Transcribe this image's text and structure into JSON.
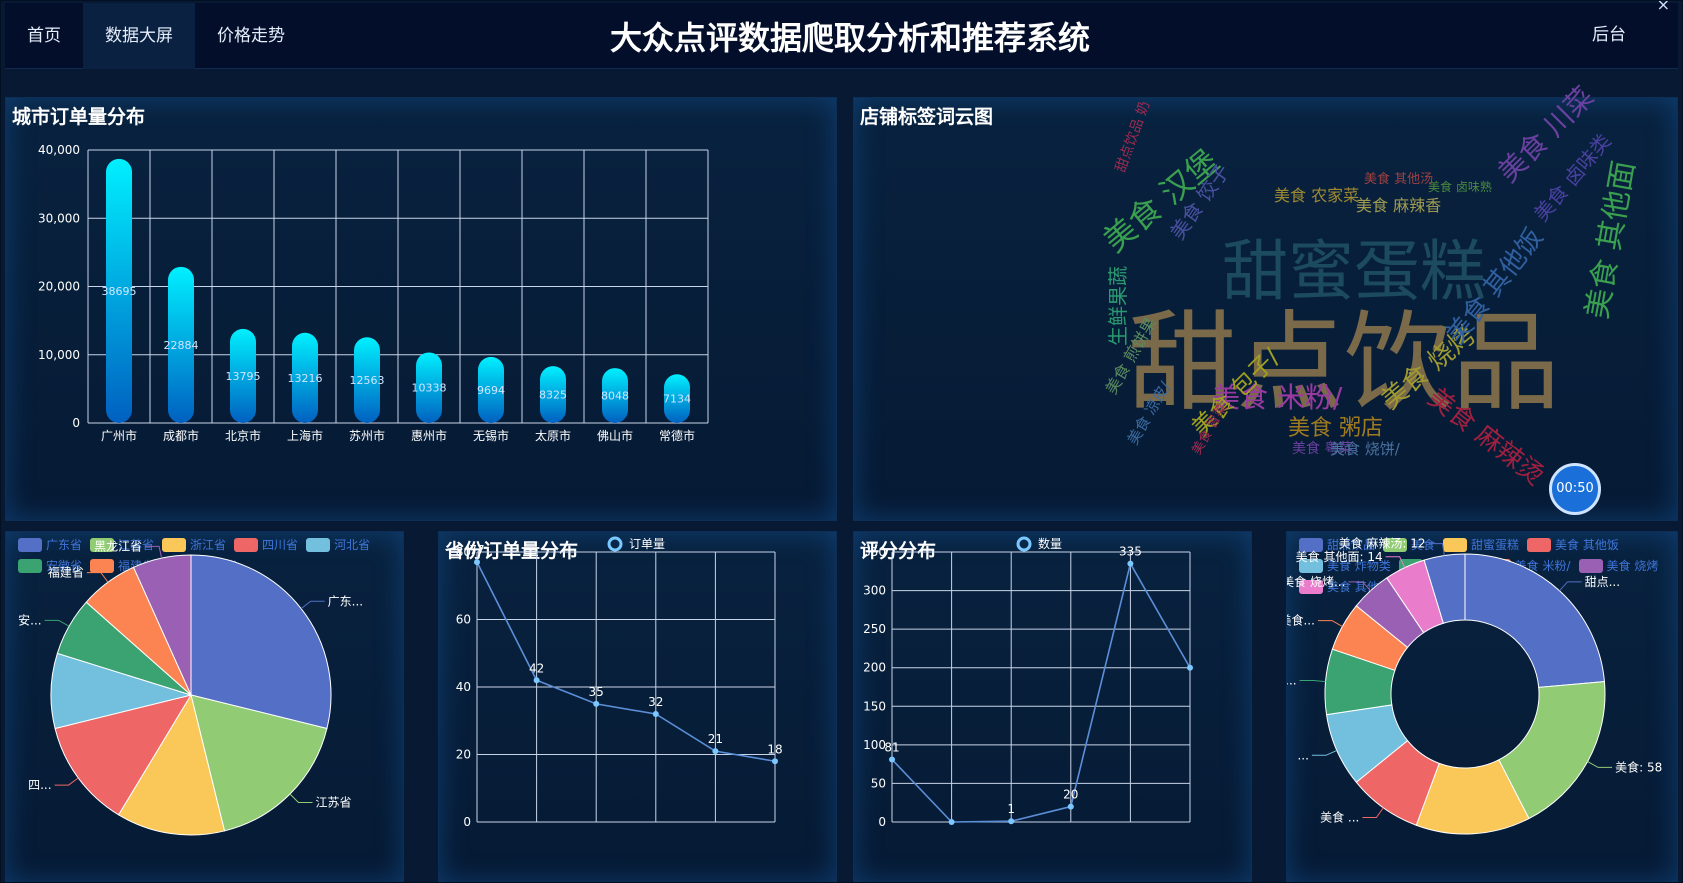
{
  "header": {
    "nav": [
      {
        "label": "首页"
      },
      {
        "label": "数据大屏"
      },
      {
        "label": "价格走势"
      }
    ],
    "title": "大众点评数据爬取分析和推荐系统",
    "admin": "后台"
  },
  "timer": "00:50",
  "colors": [
    "#5470c6",
    "#91cc75",
    "#fac858",
    "#ee6666",
    "#73c0de",
    "#3ba272",
    "#fc8452",
    "#9a60b4",
    "#ea7ccc"
  ],
  "panels": {
    "city": "城市订单量分布",
    "cloud": "店铺标签词云图",
    "prov_line": "省份订单量分布",
    "score": "评分分布"
  },
  "chart_data": [
    {
      "type": "bar",
      "id": "city",
      "categories": [
        "广州市",
        "成都市",
        "北京市",
        "上海市",
        "苏州市",
        "惠州市",
        "无锡市",
        "太原市",
        "佛山市",
        "常德市"
      ],
      "values": [
        38695,
        22884,
        13795,
        13216,
        12563,
        10338,
        9694,
        8325,
        8048,
        7134
      ],
      "ylim": [
        0,
        40000
      ],
      "yticks": [
        "0",
        "10,000",
        "20,000",
        "30,000",
        "40,000"
      ]
    },
    {
      "type": "pie",
      "id": "province",
      "legend": [
        "广东省",
        "江苏省",
        "浙江省",
        "四川省",
        "河北省",
        "安徽省",
        "福建省",
        "黑龙江省"
      ],
      "values": [
        30,
        18,
        13,
        13,
        9,
        7,
        7,
        7
      ],
      "labels": [
        "广东...",
        "江苏省",
        "",
        "四...",
        "",
        "安...",
        "福建省",
        "黑龙江省"
      ]
    },
    {
      "type": "line",
      "id": "prov_line",
      "series": [
        {
          "name": "订单量",
          "values": [
            77,
            42,
            35,
            32,
            21,
            18
          ]
        }
      ],
      "ylim": [
        0,
        80
      ],
      "yticks": [
        "0",
        "20",
        "40",
        "60",
        "80"
      ]
    },
    {
      "type": "line",
      "id": "score",
      "series": [
        {
          "name": "数量",
          "values": [
            81,
            0,
            1,
            20,
            335,
            200
          ]
        }
      ],
      "point_labels": [
        "81",
        "",
        "1",
        "20",
        "335",
        ""
      ],
      "ylim": [
        0,
        350
      ],
      "yticks": [
        "0",
        "50",
        "100",
        "150",
        "200",
        "250",
        "300",
        "350"
      ]
    },
    {
      "type": "pie",
      "id": "tags",
      "legend": [
        "甜点饮品",
        "美食",
        "甜蜜蛋糕",
        "美食 其他饭",
        "美食 炸物类",
        "美食 汉堡",
        "美食 米粉/",
        "美食 烧烤",
        "美食 其他面",
        "美食 麻辣烫"
      ],
      "values": [
        25,
        20,
        14,
        9,
        9,
        8,
        6,
        5,
        5,
        5
      ],
      "labels": [
        "甜点...",
        "美食: 58",
        "",
        "美食 ...",
        "...",
        "...",
        "美食...",
        "美食 烧烤...",
        "美食 其他面: 14",
        "美食 麻辣汤: 12"
      ]
    }
  ],
  "wordcloud": [
    {
      "t": "甜点饮品",
      "c": "#7a6a4a"
    },
    {
      "t": "甜蜜蛋糕",
      "c": "#1c4a5e"
    },
    {
      "t": "美食 汉堡",
      "c": "#3aa050"
    },
    {
      "t": "美食 其他面",
      "c": "#3aa050"
    },
    {
      "t": "美食 米粉/",
      "c": "#9a3aa0"
    },
    {
      "t": "美食 烧烤",
      "c": "#a09a30"
    },
    {
      "t": "美食 麻辣烫",
      "c": "#a02040"
    },
    {
      "t": "美食 其他饭",
      "c": "#3060a0"
    },
    {
      "t": "美食 粥店",
      "c": "#a07a20"
    },
    {
      "t": "美食 包子/",
      "c": "#a0a020"
    },
    {
      "t": "生鲜果蔬",
      "c": "#2a9a70"
    },
    {
      "t": "美食 川菜",
      "c": "#6a40a0"
    },
    {
      "t": "美食 农家菜",
      "c": "#a08a30"
    },
    {
      "t": "美食 麻辣香",
      "c": "#a09a50"
    },
    {
      "t": "美食 卤味熟",
      "c": "#4a8a40"
    },
    {
      "t": "美食 饺子",
      "c": "#4a50a0"
    },
    {
      "t": "美食 卤味类",
      "c": "#4a40a0"
    },
    {
      "t": "美食 煎饼果",
      "c": "#5a8a60"
    },
    {
      "t": "美食 凉皮/",
      "c": "#3a6aa0"
    },
    {
      "t": "美食 粤菜",
      "c": "#6a40a0"
    },
    {
      "t": "美食 烧饼/",
      "c": "#4a70a0"
    },
    {
      "t": "甜点饮品 奶",
      "c": "#a02a50"
    },
    {
      "t": "美食 其他汤",
      "c": "#a04040"
    },
    {
      "t": "美食 冒菜",
      "c": "#a02a50"
    }
  ]
}
